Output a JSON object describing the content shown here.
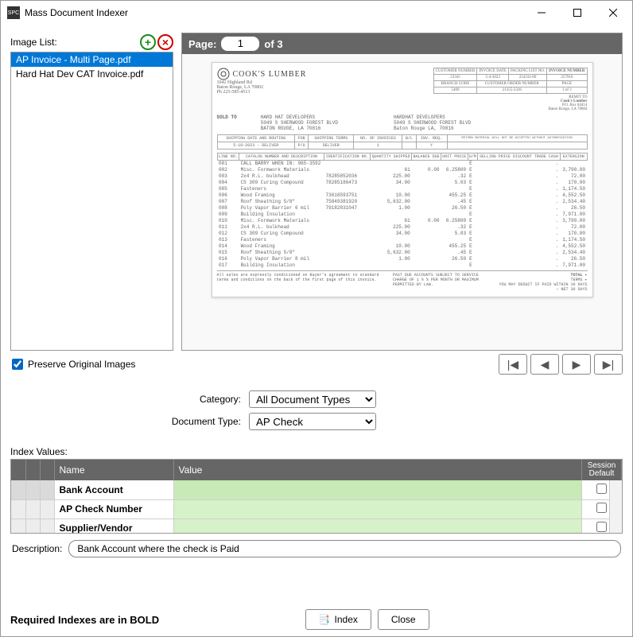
{
  "window": {
    "title": "Mass Document Indexer"
  },
  "image_list": {
    "label": "Image List:",
    "items": [
      {
        "name": "AP Invoice - Multi Page.pdf",
        "selected": true
      },
      {
        "name": "Hard Hat Dev CAT Invoice.pdf",
        "selected": false
      }
    ]
  },
  "preview": {
    "page_label": "Page:",
    "page_current": "1",
    "page_of": "of",
    "page_total": "3",
    "document": {
      "company": "COOK'S LUMBER",
      "addr1": "1042 Highland Rd",
      "addr2": "Baton Rouge, LA 70802",
      "addr3": "Ph 225-585-4513",
      "sold_to_label": "SOLD TO",
      "sold_to": [
        "HARD HAT DEVELOPERS",
        "5049 S SHERWOOD FOREST BLVD",
        "BATON ROUGE, LA 70816"
      ],
      "ship_to": [
        "HARDHAT DEVELOPERS",
        "5049 S SHERWOOD FOREST BLVD",
        "Baton Rouge LA, 70816"
      ],
      "remit_to_label": "REMIT TO",
      "remit_to": [
        "Cook's Lumber",
        "P.O. Box 84414",
        "Baton Rouge, LA 70804"
      ],
      "header_fields": {
        "customer_number_label": "CUSTOMER NUMBER",
        "customer_number": "23345",
        "invoice_date_label": "INVOICE DATE",
        "invoice_date": "5-4-2023",
        "packing_list_label": "PACKING LIST NO.",
        "packing_list": "254332-00",
        "invoice_number_label": "INVOICE NUMBER",
        "invoice_number": "257916",
        "branch_code_label": "BRANCH CODE",
        "branch_code": "5409",
        "cust_order_label": "CUSTOMER ORDER NUMBER",
        "cust_order": "21355-2326",
        "page_label": "PAGE",
        "page": "1 of 3"
      },
      "ship_bar": {
        "ship_date_routing_label": "SHIPPING DATE AND ROUTING",
        "ship_date_routing": "5-18-2023 - DELIVER",
        "fob_label": "FOB",
        "fob": "P/U",
        "terms_label": "SHIPPING TERMS",
        "terms": "DELIVER",
        "noinv_label": "NO. OF INVOICES",
        "noinv": "1",
        "bl_label": "B/L",
        "invreq_label": "INV. REQ.",
        "invreq": "Y",
        "return_note": "RETURN MATERIAL WILL NOT BE ACCEPTED WITHOUT AUTHORIZATION"
      },
      "columns": [
        "LINE NO.",
        "CATALOG NUMBER AND DESCRIPTION",
        "IDENTIFICATION NO.",
        "QUANTITY SHIPPED",
        "BALANCE DUE",
        "UNIT PRICE",
        "U/M",
        "SELLING PRICE DISCOUNT TRADE CASH",
        "EXTENSION"
      ],
      "lines": [
        {
          "no": "001",
          "desc": "CALL BARRY WHEN IN: 965-3592",
          "id": "",
          "ship": "",
          "bal": "",
          "price": "",
          "ext": ""
        },
        {
          "no": "002",
          "desc": "Misc. Formwork Materials",
          "id": "",
          "ship": "61",
          "bal": "0.00",
          "price": "6.25800",
          "ext": "3,790.00"
        },
        {
          "no": "003",
          "desc": "2x4 R.L. bulkhead",
          "id": "78285852036",
          "ship": "225.00",
          "bal": "",
          "price": ".32",
          "ext": "72.00"
        },
        {
          "no": "004",
          "desc": "CS 309 Curing Compound",
          "id": "78285186473",
          "ship": "34.00",
          "bal": "",
          "price": "5.03",
          "ext": "170.00"
        },
        {
          "no": "005",
          "desc": "Fasteners",
          "id": "",
          "ship": "",
          "bal": "",
          "price": "",
          "ext": "1,174.50"
        },
        {
          "no": "006",
          "desc": "Wood Framing",
          "id": "73618593751",
          "ship": "10.00",
          "bal": "",
          "price": "455.25",
          "ext": "4,552.50"
        },
        {
          "no": "007",
          "desc": "Roof Sheathing 5/8\"",
          "id": "75849381920",
          "ship": "5,632.00",
          "bal": "",
          "price": ".45",
          "ext": "2,534.40"
        },
        {
          "no": "008",
          "desc": "Poly Vapor Barrier 6 mil",
          "id": "79182831047",
          "ship": "1.00",
          "bal": "",
          "price": "26.50",
          "ext": "26.50"
        },
        {
          "no": "009",
          "desc": "Building Insulation",
          "id": "",
          "ship": "",
          "bal": "",
          "price": "",
          "ext": "7,971.00"
        },
        {
          "no": "010",
          "desc": "Misc. Formwork Materials",
          "id": "",
          "ship": "61",
          "bal": "0.00",
          "price": "6.25800",
          "ext": "3,790.00"
        },
        {
          "no": "011",
          "desc": "2x4 R.L. bulkhead",
          "id": "",
          "ship": "225.00",
          "bal": "",
          "price": ".32",
          "ext": "72.00"
        },
        {
          "no": "012",
          "desc": "CS 309 Curing Compound",
          "id": "",
          "ship": "34.00",
          "bal": "",
          "price": "5.03",
          "ext": "170.00"
        },
        {
          "no": "013",
          "desc": "Fasteners",
          "id": "",
          "ship": "",
          "bal": "",
          "price": "",
          "ext": "1,174.50"
        },
        {
          "no": "014",
          "desc": "Wood Framing",
          "id": "",
          "ship": "10.00",
          "bal": "",
          "price": "455.25",
          "ext": "4,552.50"
        },
        {
          "no": "015",
          "desc": "Roof Sheathing 5/8\"",
          "id": "",
          "ship": "5,632.00",
          "bal": "",
          "price": ".45",
          "ext": "2,534.40"
        },
        {
          "no": "016",
          "desc": "Poly Vapor Barrier 8 mil",
          "id": "",
          "ship": "1.00",
          "bal": "",
          "price": "26.50",
          "ext": "26.50"
        },
        {
          "no": "017",
          "desc": "Building Insulation",
          "id": "",
          "ship": "",
          "bal": "",
          "price": "",
          "ext": "7,971.00"
        }
      ],
      "footer_note1": "All sales are expressly conditioned on Buyer's agreement to standard terms and conditions on the back of the first page of this invoice.",
      "footer_note2": "PAST DUE ACCOUNTS SUBJECT TO SERVICE CHARGE OF 1 ½ % PER MONTH OR MAXIMUM PERMITTED BY LAW.",
      "total_label": "TOTAL",
      "terms_label": "TERMS",
      "deduct_note": "YOU MAY DEDUCT IF PAID WITHIN 10 DAYS — NET 30 DAYS"
    }
  },
  "preserve_label": "Preserve Original Images",
  "preserve_checked": true,
  "form": {
    "category_label": "Category:",
    "category_value": "All Document Types",
    "doctype_label": "Document Type:",
    "doctype_value": "AP Check"
  },
  "index_values_label": "Index Values:",
  "grid": {
    "cols": {
      "name": "Name",
      "value": "Value",
      "session_default": "Session Default"
    },
    "rows": [
      {
        "name": "Bank Account",
        "value": "",
        "sd": false,
        "focused": true
      },
      {
        "name": "AP Check Number",
        "value": "",
        "sd": false,
        "focused": false
      },
      {
        "name": "Supplier/Vendor",
        "value": "",
        "sd": false,
        "focused": false
      }
    ]
  },
  "description_label": "Description:",
  "description_value": "Bank Account where the check is Paid",
  "footer": {
    "required_note": "Required Indexes are in BOLD",
    "index_btn": "Index",
    "close_btn": "Close"
  }
}
